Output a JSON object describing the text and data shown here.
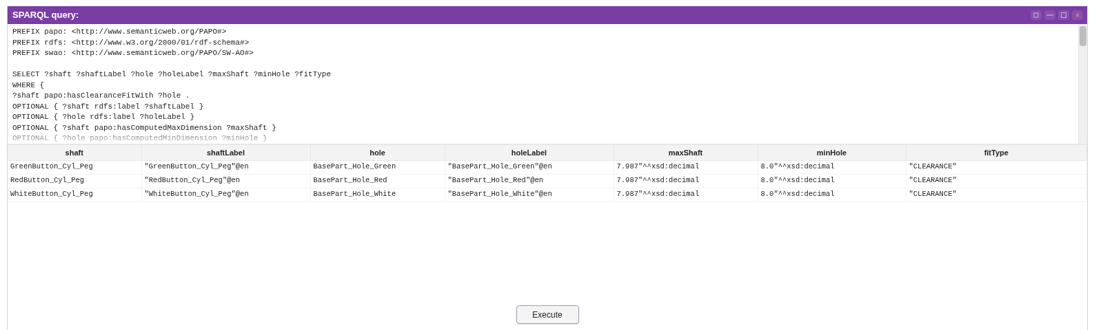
{
  "window": {
    "title": "SPARQL query:"
  },
  "query": {
    "blocks": [
      [
        "PREFIX papo: <http://www.semanticweb.org/PAPO#>",
        "PREFIX rdfs: <http://www.w3.org/2000/01/rdf-schema#>",
        "PREFIX swao: <http://www.semanticweb.org/PAPO/SW-AO#>"
      ],
      [
        "SELECT ?shaft ?shaftLabel ?hole ?holeLabel ?maxShaft ?minHole ?fitType",
        "WHERE {",
        "?shaft papo:hasClearanceFitWith ?hole .",
        "OPTIONAL { ?shaft rdfs:label ?shaftLabel }",
        "OPTIONAL { ?hole rdfs:label ?holeLabel }",
        "OPTIONAL { ?shaft papo:hasComputedMaxDimension ?maxShaft }",
        "OPTIONAL { ?hole papo:hasComputedMinDimension ?minHole }"
      ]
    ]
  },
  "table": {
    "columns": [
      "shaft",
      "shaftLabel",
      "hole",
      "holeLabel",
      "maxShaft",
      "minHole",
      "fitType"
    ],
    "rows": [
      [
        "GreenButton_Cyl_Peg",
        "\"GreenButton_Cyl_Peg\"@en",
        "BasePart_Hole_Green",
        "\"BasePart_Hole_Green\"@en",
        "7.987\"^^xsd:decimal",
        "8.0\"^^xsd:decimal",
        "\"CLEARANCE\""
      ],
      [
        "RedButton_Cyl_Peg",
        "\"RedButton_Cyl_Peg\"@en",
        "BasePart_Hole_Red",
        "\"BasePart_Hole_Red\"@en",
        "7.987\"^^xsd:decimal",
        "8.0\"^^xsd:decimal",
        "\"CLEARANCE\""
      ],
      [
        "WhiteButton_Cyl_Peg",
        "\"WhiteButton_Cyl_Peg\"@en",
        "BasePart_Hole_White",
        "\"BasePart_Hole_White\"@en",
        "7.987\"^^xsd:decimal",
        "8.0\"^^xsd:decimal",
        "\"CLEARANCE\""
      ]
    ]
  },
  "buttons": [
    "Execute"
  ]
}
